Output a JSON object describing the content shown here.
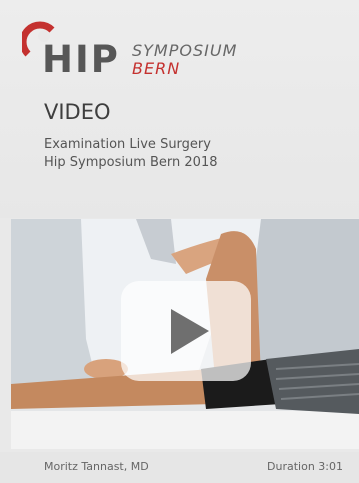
{
  "logo": {
    "main": "HIP",
    "line1": "SYMPOSIUM",
    "line2": "BERN"
  },
  "section_label": "VIDEO",
  "subtitle_lines": [
    "Examination Live Surgery",
    "Hip Symposium Bern 2018"
  ],
  "video": {
    "play_icon": "play-icon"
  },
  "footer": {
    "author": "Moritz Tannast, MD",
    "duration": "Duration 3:01"
  },
  "colors": {
    "brand_red": "#c4312f",
    "text_dark": "#3e3e3e",
    "background": "#e9e9e9"
  }
}
